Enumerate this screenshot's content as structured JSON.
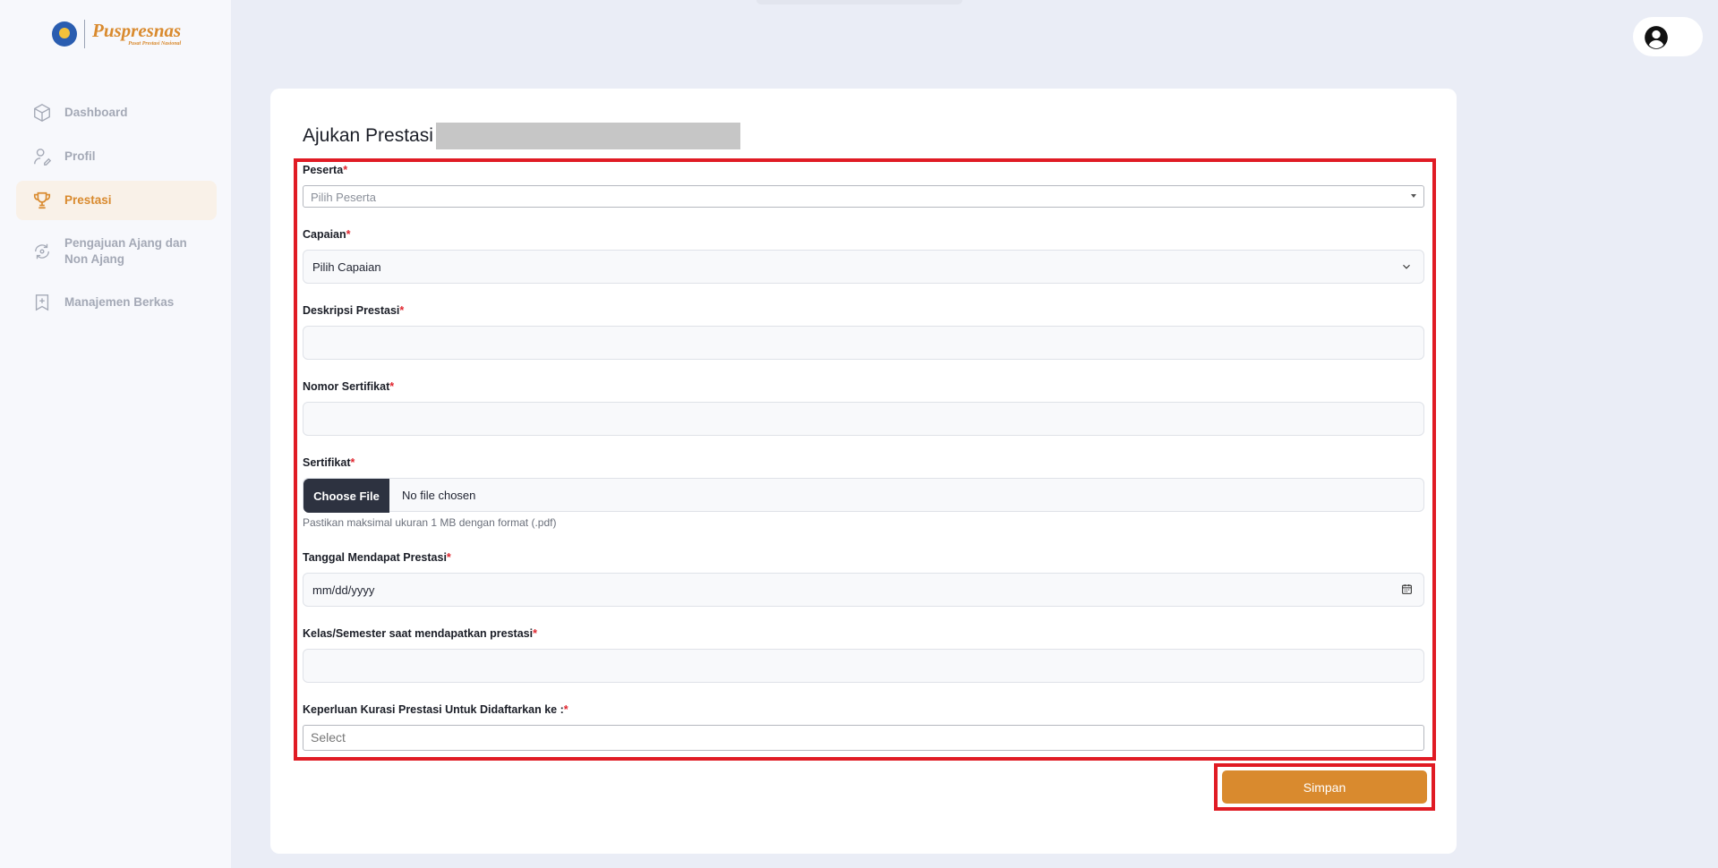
{
  "brand": {
    "name": "Puspresnas",
    "tagline": "Pusat Prestasi Nasional"
  },
  "sidebar": {
    "items": [
      {
        "label": "Dashboard",
        "icon": "cube-icon",
        "active": false
      },
      {
        "label": "Profil",
        "icon": "user-edit-icon",
        "active": false
      },
      {
        "label": "Prestasi",
        "icon": "trophy-icon",
        "active": true
      },
      {
        "label": "Pengajuan Ajang dan Non Ajang",
        "icon": "cycle-icon",
        "active": false
      },
      {
        "label": "Manajemen Berkas",
        "icon": "bookmark-plus-icon",
        "active": false
      }
    ]
  },
  "header": {
    "avatar_icon": "user-circle-icon"
  },
  "page": {
    "title": "Ajukan Prestasi"
  },
  "form": {
    "peserta": {
      "label": "Peserta",
      "required": "*",
      "placeholder": "Pilih Peserta"
    },
    "capaian": {
      "label": "Capaian",
      "required": "*",
      "value": "Pilih Capaian"
    },
    "deskripsi": {
      "label": "Deskripsi Prestasi",
      "required": "*",
      "value": ""
    },
    "nomor": {
      "label": "Nomor Sertifikat",
      "required": "*",
      "value": ""
    },
    "sertifikat": {
      "label": "Sertifikat",
      "required": "*",
      "button": "Choose File",
      "status": "No file chosen",
      "help": "Pastikan maksimal ukuran 1 MB dengan format (.pdf)"
    },
    "tanggal": {
      "label": "Tanggal Mendapat Prestasi",
      "required": "*",
      "placeholder": "mm/dd/yyyy"
    },
    "kelas": {
      "label": "Kelas/Semester saat mendapatkan prestasi",
      "required": "*",
      "value": ""
    },
    "keperluan": {
      "label": "Keperluan Kurasi Prestasi Untuk Didaftarkan ke :",
      "required": "*",
      "placeholder": "Select"
    }
  },
  "actions": {
    "save_label": "Simpan"
  },
  "colors": {
    "accent": "#d98a2e",
    "highlight": "#e01b24",
    "dark_button": "#2d3240"
  }
}
